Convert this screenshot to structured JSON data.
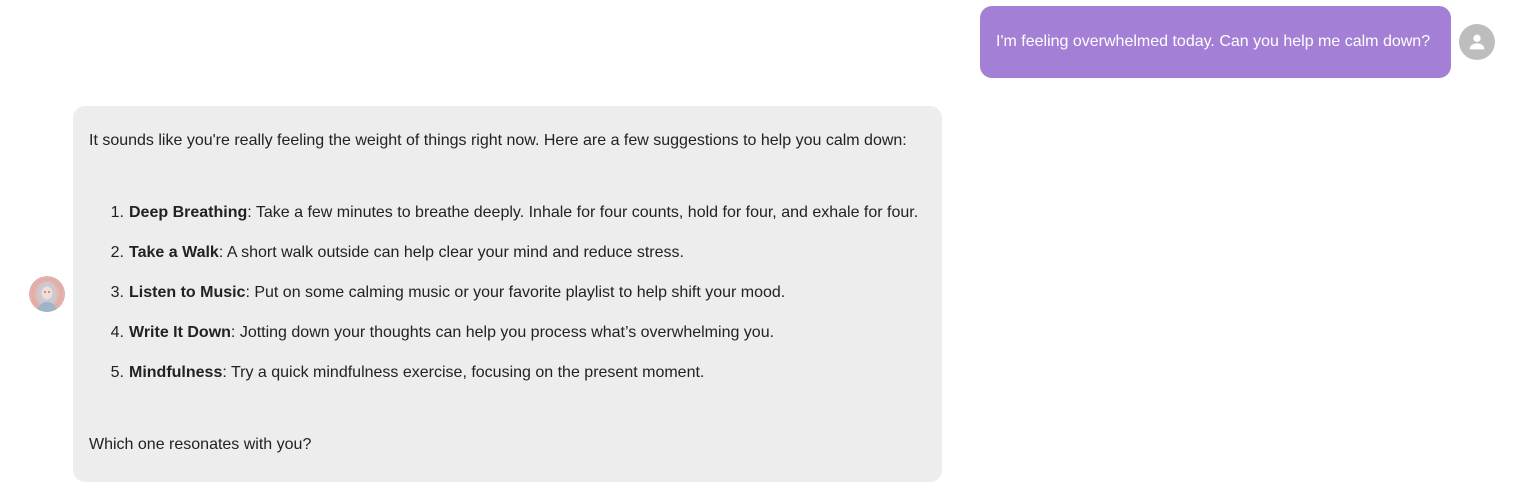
{
  "user_message": {
    "text": "I'm feeling overwhelmed today. Can you help me calm down?",
    "bubble_color": "#a47fd6"
  },
  "user_avatar": {
    "icon": "person-icon"
  },
  "assistant_avatar": {
    "icon": "assistant-portrait-avatar"
  },
  "assistant_message": {
    "bubble_color": "#ededed",
    "intro": "It sounds like you're really feeling the weight of things right now. Here are a few suggestions to help you calm down:",
    "items": [
      {
        "number": "1.",
        "term": "Deep Breathing",
        "desc": ": Take a few minutes to breathe deeply. Inhale for four counts, hold for four, and exhale for four."
      },
      {
        "number": "2.",
        "term": "Take a Walk",
        "desc": ": A short walk outside can help clear your mind and reduce stress."
      },
      {
        "number": "3.",
        "term": "Listen to Music",
        "desc": ": Put on some calming music or your favorite playlist to help shift your mood."
      },
      {
        "number": "4.",
        "term": "Write It Down",
        "desc": ": Jotting down your thoughts can help you process what’s overwhelming you."
      },
      {
        "number": "5.",
        "term": "Mindfulness",
        "desc": ": Try a quick mindfulness exercise, focusing on the present moment."
      }
    ],
    "outro": "Which one resonates with you?"
  }
}
